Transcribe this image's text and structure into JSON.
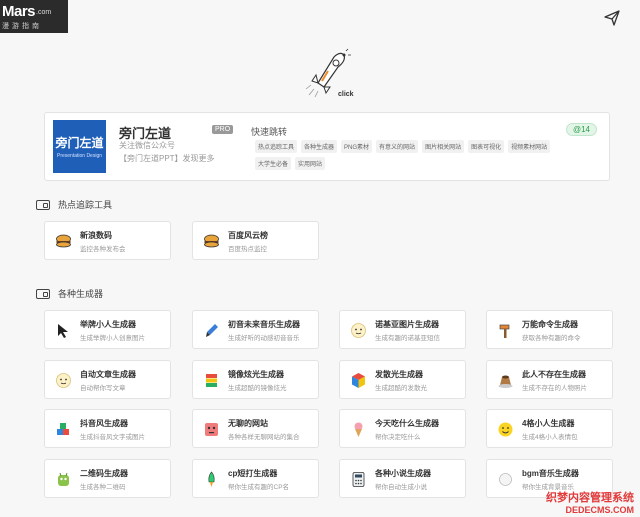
{
  "logo": {
    "brand": "Mars",
    "com": ".com",
    "sub": "漫游指南"
  },
  "hero": {
    "caption": "click"
  },
  "profile": {
    "image_line1": "旁门左道",
    "image_line2": "Presentation Design",
    "name": "旁门左道",
    "badge": "PRO",
    "line1": "关注微信公众号",
    "line2": "【旁门左道PPT】发现更多",
    "quick_jump": "快速跳转",
    "count": "14",
    "tags": [
      "热点追踪工具",
      "各种生成器",
      "PNG素材",
      "有意义的网站",
      "图片相关网站",
      "图表可视化",
      "视频素材网站",
      "大学生必备",
      "实用网站"
    ]
  },
  "sections": {
    "hot": {
      "title": "热点追踪工具"
    },
    "gen": {
      "title": "各种生成器"
    }
  },
  "hot_items": [
    {
      "name": "新浪数码",
      "desc": "监控各种发布会",
      "icon": "burger-icon"
    },
    {
      "name": "百度风云榜",
      "desc": "百度热点监控",
      "icon": "burger-icon"
    }
  ],
  "gen_items": [
    {
      "name": "举牌小人生成器",
      "desc": "生成举牌小人创意图片",
      "icon": "cursor-icon"
    },
    {
      "name": "初音未来音乐生成器",
      "desc": "生成好听的动感初音音乐",
      "icon": "brush-icon"
    },
    {
      "name": "诺基亚图片生成器",
      "desc": "生成有趣的诺基亚短信",
      "icon": "face-icon"
    },
    {
      "name": "万能命令生成器",
      "desc": "获取各种有趣的命令",
      "icon": "hammer-icon"
    },
    {
      "name": "自动文章生成器",
      "desc": "自动帮你写文章",
      "icon": "face-icon"
    },
    {
      "name": "镜像炫光生成器",
      "desc": "生成超酷的镜像炫光",
      "icon": "stack-icon"
    },
    {
      "name": "发散光生成器",
      "desc": "生成超酷的发散光",
      "icon": "cube-icon"
    },
    {
      "name": "此人不存在生成器",
      "desc": "生成不存在的人物照片",
      "icon": "pudding-icon"
    },
    {
      "name": "抖音风生成器",
      "desc": "生成抖音风文字或图片",
      "icon": "blocks-icon"
    },
    {
      "name": "无聊的网站",
      "desc": "各种各样无聊网站的集合",
      "icon": "robot-icon"
    },
    {
      "name": "今天吃什么生成器",
      "desc": "帮你决定吃什么",
      "icon": "icecream-icon"
    },
    {
      "name": "4格小人生成器",
      "desc": "生成4格小人表情包",
      "icon": "smile-icon"
    },
    {
      "name": "二维码生成器",
      "desc": "生成各种二维码",
      "icon": "monster-icon"
    },
    {
      "name": "cp短打生成器",
      "desc": "帮你生成有趣的CP名",
      "icon": "rocket-icon"
    },
    {
      "name": "各种小说生成器",
      "desc": "帮你自动生成小说",
      "icon": "calculator-icon"
    },
    {
      "name": "bgm音乐生成器",
      "desc": "帮你生成背景音乐",
      "icon": "circle-icon"
    }
  ],
  "watermark": {
    "line1": "织梦内容管理系统",
    "line2": "DEDECMS.COM"
  }
}
